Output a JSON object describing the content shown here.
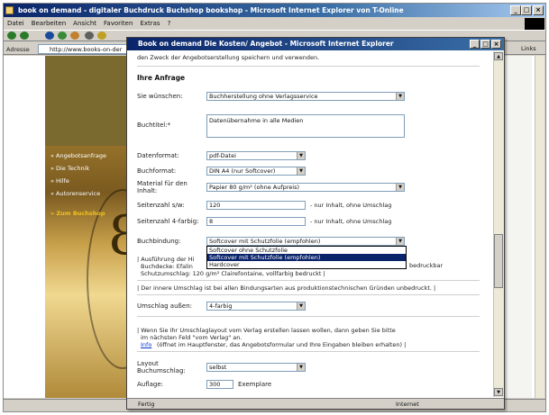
{
  "browser": {
    "title": "book on demand - digitaler Buchdruck Buchshop bookshop - Microsoft Internet Explorer von T-Online",
    "menu": [
      "Datei",
      "Bearbeiten",
      "Ansicht",
      "Favoriten",
      "Extras",
      "?"
    ],
    "address_label": "Adresse",
    "address": "http://www.books-on-der",
    "links_label": "Links",
    "min": "_",
    "max": "□",
    "close": "×"
  },
  "sidebar": {
    "items": [
      "» Angebotsanfrage",
      "» Die Technik",
      "» Hilfe",
      "» Autorenservice",
      "» Zum Buchshop"
    ],
    "clock_text": "8"
  },
  "popup": {
    "title": "Book on demand Die Kosten/ Angebot - Microsoft Internet Explorer",
    "intro": "den Zweck der Angebotserstellung speichern und verwenden.",
    "section_title": "Ihre Anfrage",
    "fields": [
      {
        "label": "Sie wünschen:",
        "value": "Buchherstellung ohne Verlagsservice"
      },
      {
        "label": "Buchtitel:*",
        "value": "Datenübernahme in alle Medien"
      },
      {
        "label": "Datenformat:",
        "value": "pdf-Datei"
      },
      {
        "label": "Buchformat:",
        "value": "DIN A4 (nur Softcover)"
      },
      {
        "label": "Material für den Inhalt:",
        "value": "Papier 80 g/m² (ohne Aufpreis)"
      },
      {
        "label": "Seitenzahl s/w:",
        "value": "120",
        "suffix": "- nur Inhalt, ohne Umschlag"
      },
      {
        "label": "Seitenzahl 4-farbig:",
        "value": "8",
        "suffix": "- nur Inhalt, ohne Umschlag"
      },
      {
        "label": "Buchbindung:",
        "value": "Softcover mit Schutzfolie (empfohlen)"
      }
    ],
    "dropdown_options": [
      "Softcover ohne Schutzfolie",
      "Softcover mit Schutzfolie (empfohlen)",
      "Hardcover"
    ],
    "desc_line1": "| Ausführung der Hi",
    "desc_line1b": "bedruckbar",
    "desc_line2": "Buchdecke: Efalin",
    "desc_line3": "Schutzumschlag: 120 g/m² Clairefontaine, vollfarbig bedruckt |",
    "inner_note": "| Der innere Umschlag ist bei allen Bindungsarten aus produktionstechnischen Gründen unbedruckt. |",
    "umschlag_label": "Umschlag außen:",
    "umschlag_value": "4-farbig",
    "layout_note1": "| Wenn Sie Ihr Umschlaglayout vom Verlag erstellen lassen wollen, dann geben Sie bitte",
    "layout_note2": "im nächsten Feld \"vom Verlag\" an.",
    "info_link": "Info",
    "info_note": "(öffnet im Hauptfenster, das Angebotsformular und Ihre Eingaben bleiben erhalten) |",
    "layout_label": "Layout Buchumschlag:",
    "layout_value": "selbst",
    "auflage_label": "Auflage:",
    "auflage_value": "300",
    "auflage_unit": "Exemplare",
    "status": "Fertig",
    "zone": "Internet"
  }
}
